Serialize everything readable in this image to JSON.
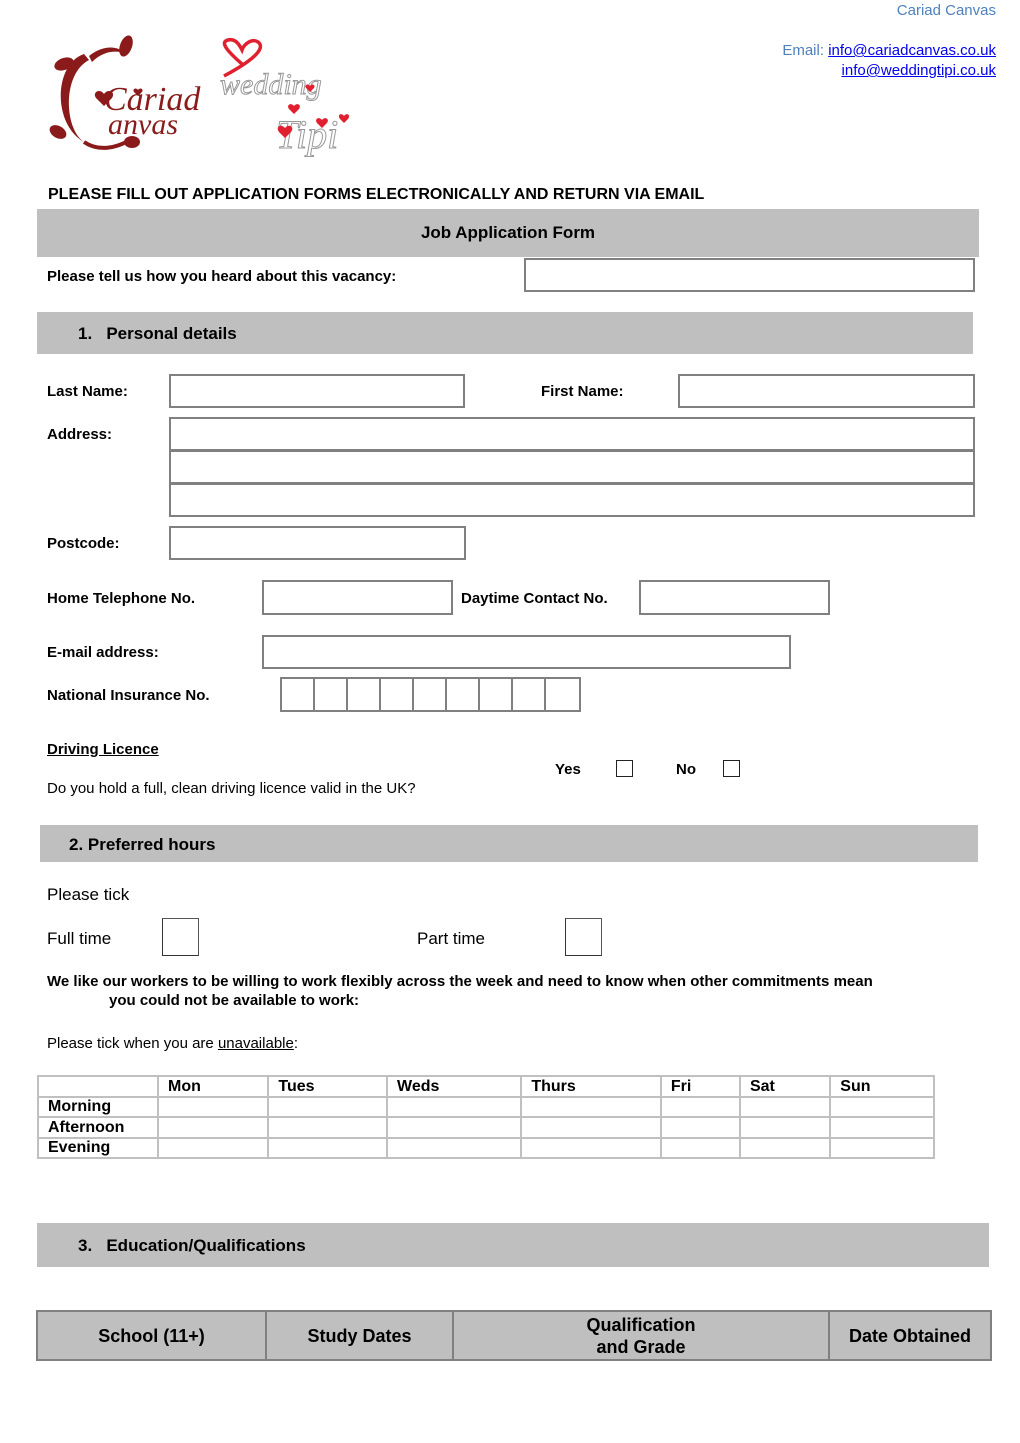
{
  "header": {
    "company": "Cariad Canvas",
    "email_label": "Email:",
    "emails": [
      "info@cariadcanvas.co.uk",
      "info@weddingtipi.co.uk"
    ],
    "logos": {
      "cariad_canvas": {
        "line1": "Cariad",
        "line2": "Canvas",
        "color": "#8b1a1a"
      },
      "wedding_tipi": {
        "line1": "wedding",
        "line2": "Tipi",
        "accent": "#e0202e"
      }
    }
  },
  "instruction": "PLEASE FILL OUT APPLICATION FORMS ELECTRONICALLY AND RETURN VIA EMAIL",
  "form_title": "Job Application Form",
  "vacancy": {
    "label": "Please tell us how you heard about this vacancy:",
    "value": ""
  },
  "section1": {
    "title": "1.   Personal details",
    "last_name": {
      "label": "Last Name:",
      "value": ""
    },
    "first_name": {
      "label": "First Name:",
      "value": ""
    },
    "address": {
      "label": "Address:",
      "lines": [
        "",
        "",
        ""
      ]
    },
    "postcode": {
      "label": "Postcode:",
      "value": ""
    },
    "home_phone": {
      "label": "Home Telephone No.",
      "value": ""
    },
    "daytime_phone": {
      "label": "Daytime Contact No.",
      "value": ""
    },
    "email": {
      "label": "E-mail address:",
      "value": ""
    },
    "ni": {
      "label": "National Insurance No.",
      "cells": 9
    },
    "driving": {
      "heading": "Driving Licence",
      "question": "Do you hold a full, clean driving licence valid in the UK?",
      "yes_label": "Yes",
      "no_label": "No"
    }
  },
  "section2": {
    "title": "2. Preferred hours",
    "please_tick": "Please tick",
    "full_time": "Full time",
    "part_time": "Part time",
    "flex_note_line1": "We like our workers to be willing to work flexibly across the week and need to know when other commitments mean",
    "flex_note_line2": "you could not be available to work:",
    "unavail_prefix": "Please tick when you are ",
    "unavail_word": "unavailable",
    "unavail_suffix": ":",
    "table": {
      "days": [
        "Mon",
        "Tues",
        "Weds",
        "Thurs",
        "Fri",
        "Sat",
        "Sun"
      ],
      "rows": [
        "Morning",
        "Afternoon",
        "Evening"
      ]
    }
  },
  "section3": {
    "title": "3.   Education/Qualifications",
    "columns": [
      "School (11+)",
      "Study Dates",
      "Qualification and Grade",
      "Date Obtained"
    ],
    "qual_col_line1": "Qualification",
    "qual_col_line2": "and Grade"
  }
}
